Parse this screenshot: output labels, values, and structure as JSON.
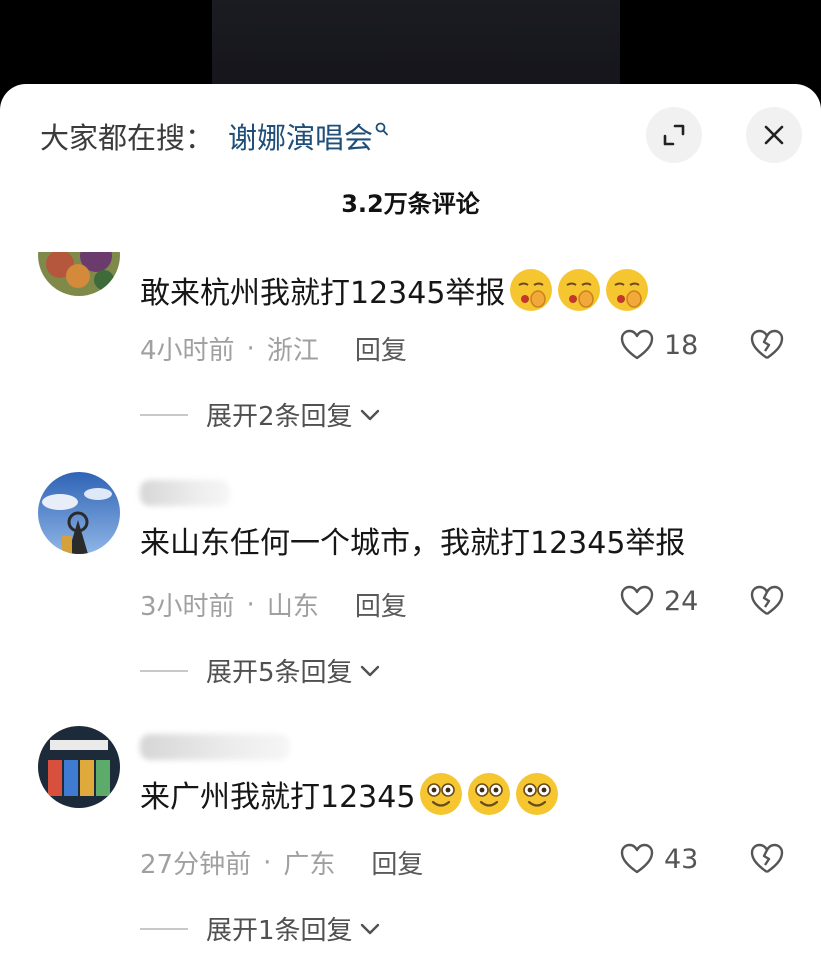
{
  "header": {
    "search_prefix": "大家都在搜：",
    "search_term": "谢娜演唱会",
    "comment_count": "3.2万条评论"
  },
  "comments": [
    {
      "text": "敢来杭州我就打12345举报",
      "time": "4小时前",
      "location": "浙江",
      "reply_label": "回复",
      "likes": "18",
      "expand_label": "展开2条回复",
      "emoji": [
        "shushing-face-icon",
        "shushing-face-icon",
        "shushing-face-icon"
      ]
    },
    {
      "text": "来山东任何一个城市，我就打12345举报",
      "time": "3小时前",
      "location": "山东",
      "reply_label": "回复",
      "likes": "24",
      "expand_label": "展开5条回复",
      "emoji": []
    },
    {
      "text": "来广州我就打12345",
      "time": "27分钟前",
      "location": "广东",
      "reply_label": "回复",
      "likes": "43",
      "expand_label": "展开1条回复",
      "emoji": [
        "flushed-smile-icon",
        "flushed-smile-icon",
        "flushed-smile-icon"
      ]
    }
  ],
  "colors": {
    "search_term": "#1f4e79",
    "meta_gray": "#a0a0a0",
    "emoji_yellow": "#f6c631"
  }
}
